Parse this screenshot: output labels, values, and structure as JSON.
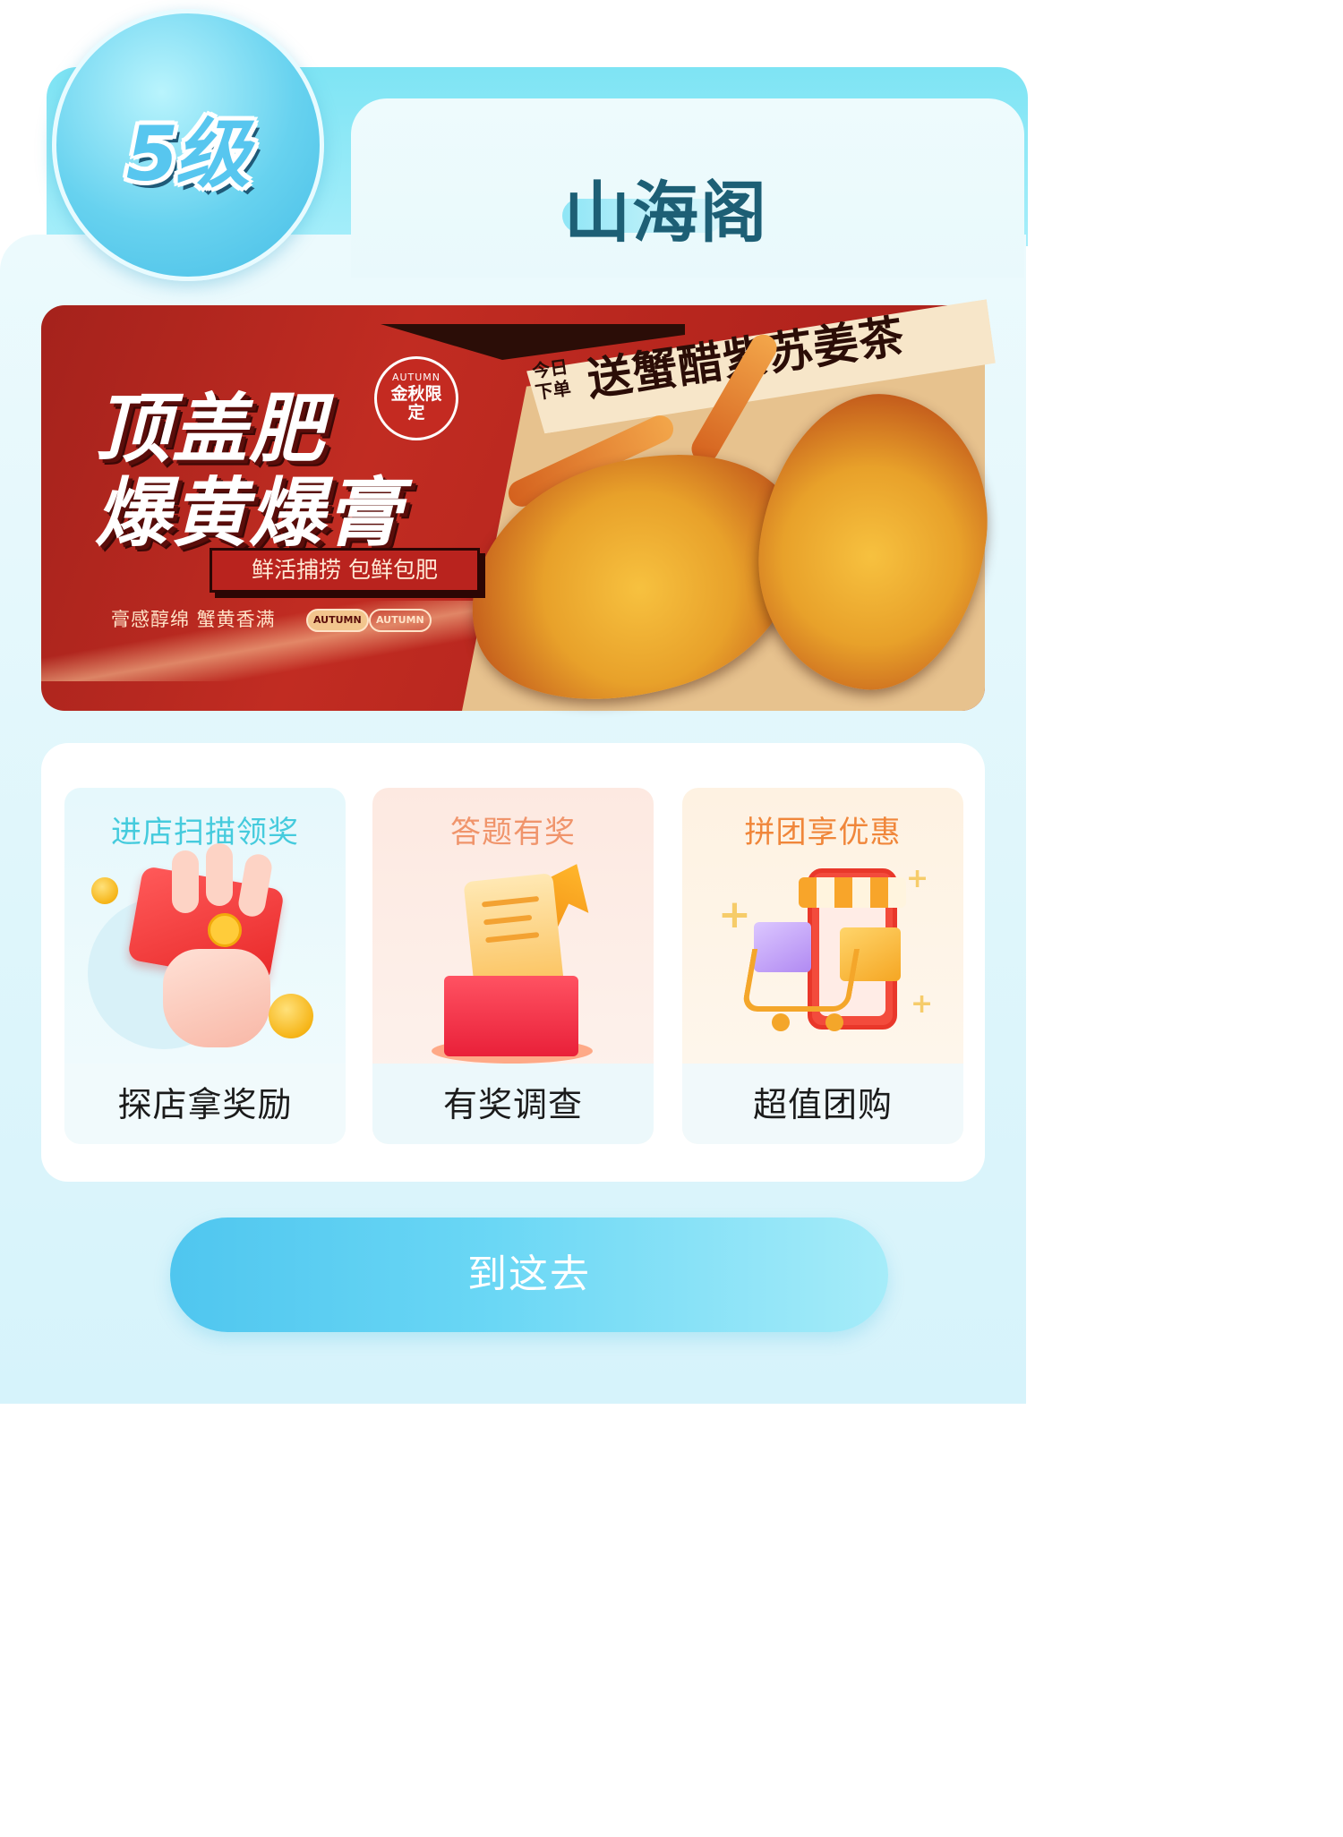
{
  "level_badge": {
    "label": "5级"
  },
  "store": {
    "name": "山海阁"
  },
  "banner": {
    "headline_line1": "顶盖肥",
    "headline_line2": "爆黄爆膏",
    "seal_en": "AUTUMN",
    "seal_cn": "金秋限定",
    "slogan": "鲜活捕捞 包鲜包肥",
    "sub_slogan": "膏感醇绵  蟹黄香满",
    "autumn_tags": [
      "AUTUMN",
      "AUTUMN"
    ],
    "promo_small": "今日下单",
    "promo_big": "送蟹醋紫苏姜茶"
  },
  "cards": [
    {
      "title": "进店扫描领奖",
      "label": "探店拿奖励",
      "icon": "red-packet-hand-icon"
    },
    {
      "title": "答题有奖",
      "label": "有奖调查",
      "icon": "gift-box-receipt-icon"
    },
    {
      "title": "拼团享优惠",
      "label": "超值团购",
      "icon": "shopping-cart-phone-icon"
    }
  ],
  "go_button": {
    "label": "到这去"
  },
  "colors": {
    "accent_cyan": "#4fc6ef",
    "store_name": "#1d5f75",
    "card1_title": "#45cbdd",
    "card2_title": "#f0946b",
    "card3_title": "#f0863a",
    "banner_red": "#b7261e"
  }
}
